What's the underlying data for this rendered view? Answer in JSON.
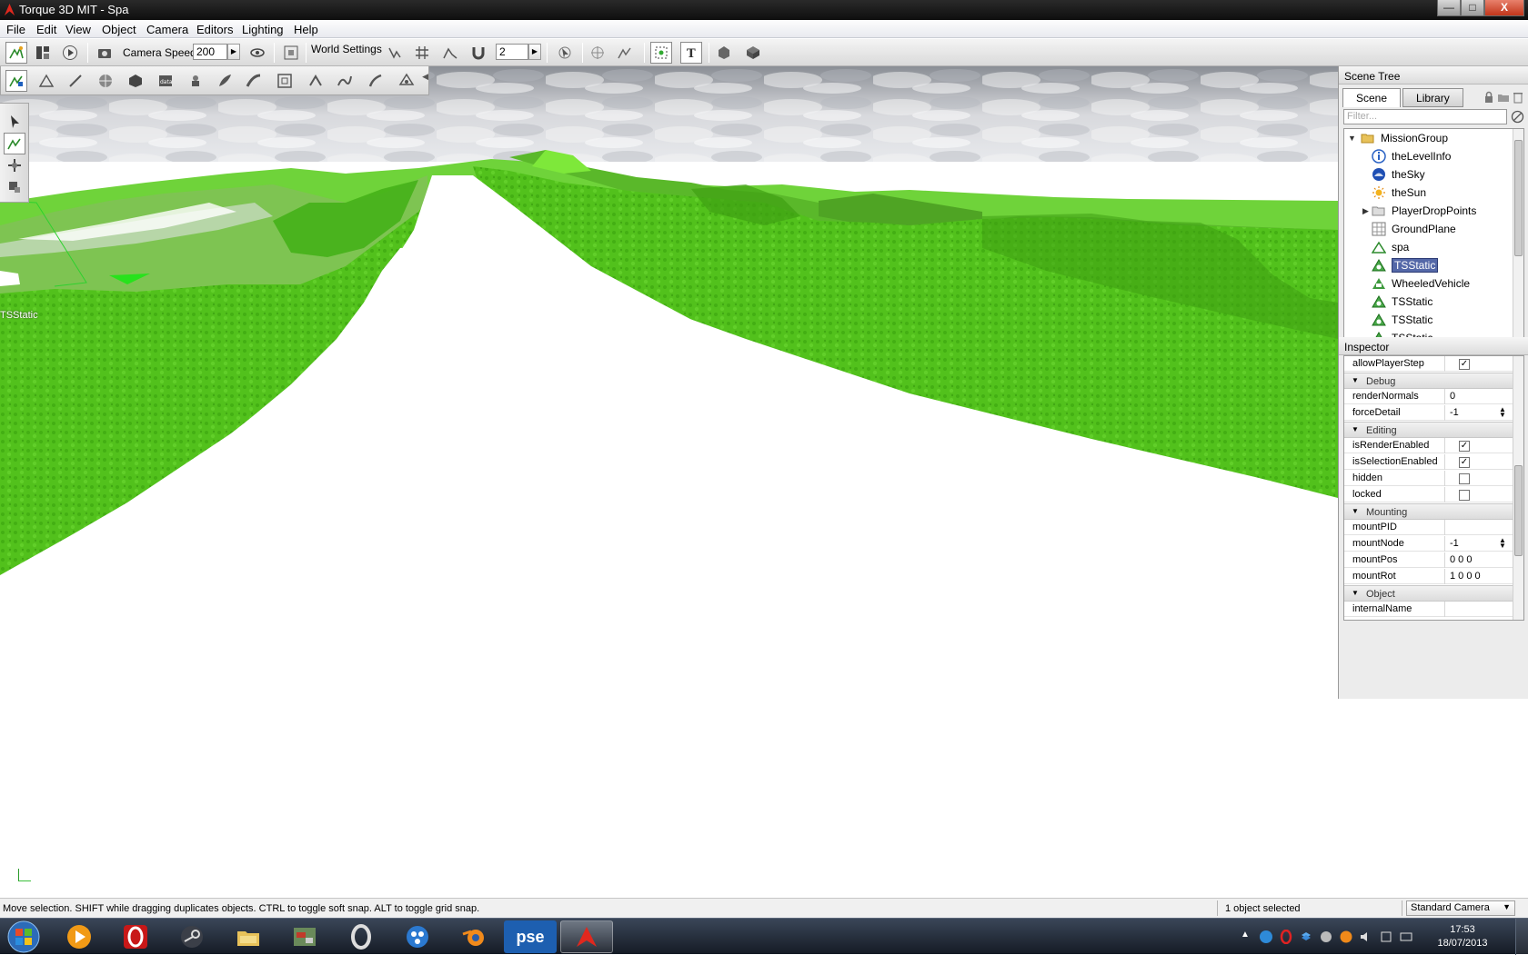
{
  "window": {
    "title": "Torque 3D MIT - Spa",
    "minimize": "—",
    "maximize": "□",
    "close": "X"
  },
  "menu": [
    "File",
    "Edit",
    "View",
    "Object",
    "Camera",
    "Editors",
    "Lighting",
    "Help"
  ],
  "toolbar": {
    "camera_speed_label": "Camera Speed",
    "camera_speed_value": "200",
    "world_settings_label": "World Settings",
    "snap_value": "2",
    "icons": [
      "world-editor-icon",
      "gui-editor-icon",
      "play-icon",
      "camera-icon",
      "eye-icon",
      "fit-selection-icon",
      "snap-icon",
      "grid-icon",
      "terrain-snap-icon",
      "magnet-icon",
      "select-mode-icon",
      "object-center-icon",
      "bounds-icon",
      "selection-lock-icon",
      "text-labels-icon",
      "drop-icon",
      "datablock-icon"
    ]
  },
  "editor_toolbar": {
    "icons": [
      "object-editor-icon",
      "terrain-editor-icon",
      "terrain-painter-icon",
      "material-editor-icon",
      "sketch-tool-icon",
      "datablock-editor-icon",
      "particle-editor-icon",
      "forest-editor-icon",
      "road-editor-icon",
      "mesh-road-editor-icon",
      "decal-editor-icon",
      "river-editor-icon",
      "shape-editor-icon",
      "navmesh-editor-icon"
    ]
  },
  "gizmo_tools": [
    "select-arrow-icon",
    "move-icon",
    "rotate-icon",
    "scale-icon"
  ],
  "viewport": {
    "selected_label": "TSStatic"
  },
  "scene_tree": {
    "title": "Scene Tree",
    "tabs": [
      "Scene",
      "Library"
    ],
    "active_tab": "Scene",
    "filter_placeholder": "Filter...",
    "items": [
      {
        "label": "MissionGroup",
        "icon": "folder-open-icon",
        "depth": 0,
        "expanded": true
      },
      {
        "label": "theLevelInfo",
        "icon": "info-icon",
        "depth": 1
      },
      {
        "label": "theSky",
        "icon": "sky-icon",
        "depth": 1
      },
      {
        "label": "theSun",
        "icon": "sun-icon",
        "depth": 1
      },
      {
        "label": "PlayerDropPoints",
        "icon": "folder-icon",
        "depth": 1,
        "collapsed": true
      },
      {
        "label": "GroundPlane",
        "icon": "grid-plane-icon",
        "depth": 1
      },
      {
        "label": "spa",
        "icon": "terrain-icon",
        "depth": 1
      },
      {
        "label": "TSStatic",
        "icon": "tsstatic-icon",
        "depth": 1,
        "selected": true
      },
      {
        "label": "WheeledVehicle",
        "icon": "vehicle-icon",
        "depth": 1
      },
      {
        "label": "TSStatic",
        "icon": "tsstatic-icon",
        "depth": 1
      },
      {
        "label": "TSStatic",
        "icon": "tsstatic-icon",
        "depth": 1
      },
      {
        "label": "TSStatic",
        "icon": "tsstatic-icon",
        "depth": 1
      }
    ]
  },
  "inspector": {
    "title": "Inspector",
    "rows": [
      {
        "type": "field",
        "key": "allowPlayerStep",
        "checkbox": true,
        "checked": true
      },
      {
        "type": "group",
        "label": "Debug"
      },
      {
        "type": "field",
        "key": "renderNormals",
        "value": "0"
      },
      {
        "type": "field",
        "key": "forceDetail",
        "value": "-1",
        "spinner": true
      },
      {
        "type": "group",
        "label": "Editing"
      },
      {
        "type": "field",
        "key": "isRenderEnabled",
        "checkbox": true,
        "checked": true
      },
      {
        "type": "field",
        "key": "isSelectionEnabled",
        "checkbox": true,
        "checked": true
      },
      {
        "type": "field",
        "key": "hidden",
        "checkbox": true,
        "checked": false
      },
      {
        "type": "field",
        "key": "locked",
        "checkbox": true,
        "checked": false
      },
      {
        "type": "group",
        "label": "Mounting"
      },
      {
        "type": "field",
        "key": "mountPID",
        "value": ""
      },
      {
        "type": "field",
        "key": "mountNode",
        "value": "-1",
        "spinner": true
      },
      {
        "type": "field",
        "key": "mountPos",
        "value": "0 0 0"
      },
      {
        "type": "field",
        "key": "mountRot",
        "value": "1 0 0 0"
      },
      {
        "type": "group",
        "label": "Object"
      },
      {
        "type": "field",
        "key": "internalName",
        "value": ""
      }
    ]
  },
  "status": {
    "message": "Move selection.  SHIFT while dragging duplicates objects.  CTRL to toggle soft snap.  ALT to toggle grid snap.",
    "selection": "1 object selected",
    "camera_mode": "Standard Camera"
  },
  "taskbar": {
    "apps": [
      "vlc-icon",
      "opera-icon",
      "steam-icon",
      "file-explorer-icon",
      "game-thumbnail-icon",
      "opera-next-icon",
      "app-blue-icon",
      "blender-icon",
      "pse-icon",
      "torque-icon"
    ],
    "pse_label": "pse",
    "active_app": "torque-icon",
    "clock_time": "17:53",
    "clock_date": "18/07/2013"
  },
  "colors": {
    "grass": "#4fc51a",
    "sky": "#c9cbd0",
    "selection": "#5468a8"
  }
}
